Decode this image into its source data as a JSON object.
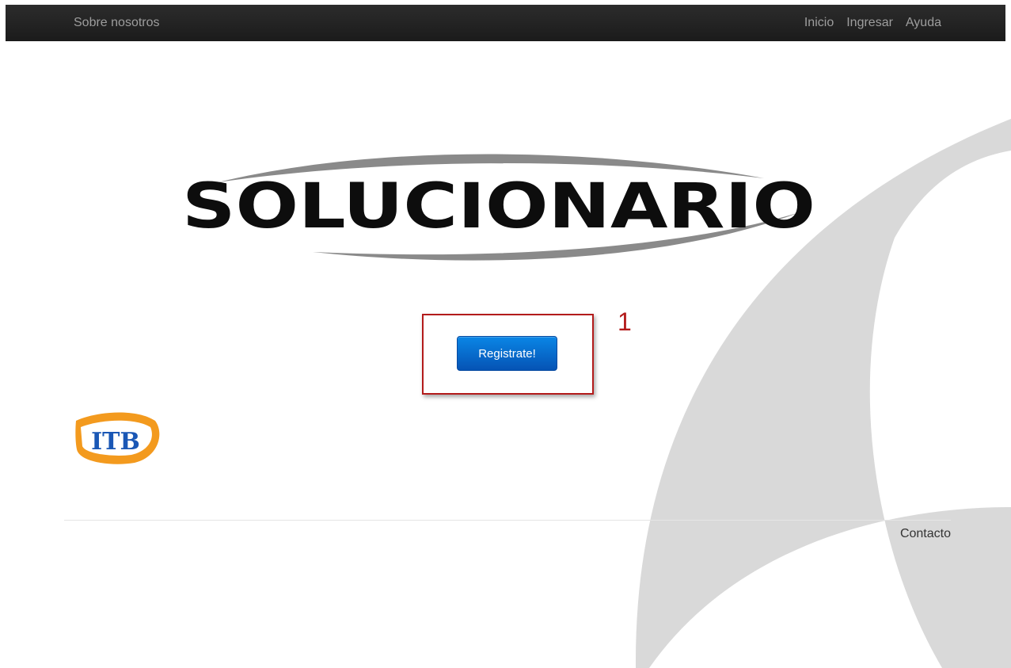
{
  "navbar": {
    "left_link": "Sobre nosotros",
    "right_links": [
      "Inicio",
      "Ingresar",
      "Ayuda"
    ]
  },
  "logo": {
    "text": "SOLUCIONARIO"
  },
  "cta": {
    "register_label": "Registrate!"
  },
  "annotation": {
    "number": "1"
  },
  "sponsor": {
    "text": "ITB"
  },
  "footer": {
    "contact_label": "Contacto"
  },
  "colors": {
    "navbar_bg": "#222222",
    "primary_button": "#0a6fd6",
    "annotation_red": "#b31b1b",
    "background_swoosh": "#d9d9d9",
    "itb_orange": "#f39a1e",
    "itb_blue": "#1a57b5"
  }
}
